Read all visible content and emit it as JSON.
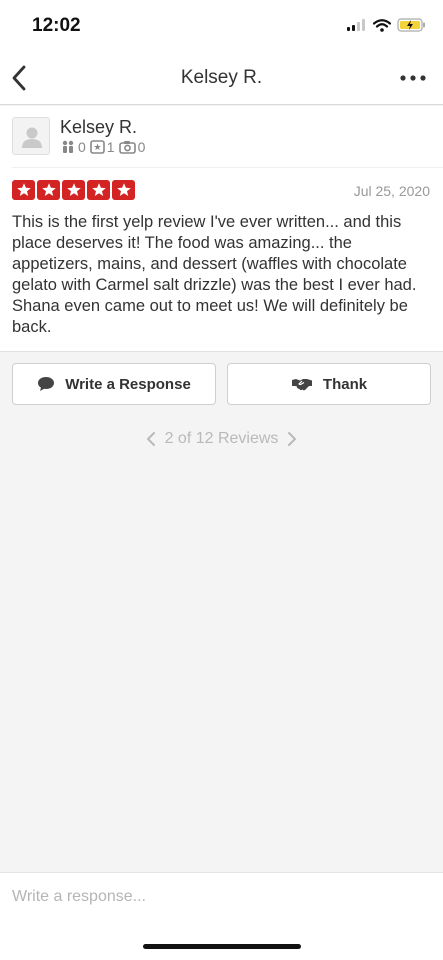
{
  "status_bar": {
    "time": "12:02"
  },
  "nav": {
    "title": "Kelsey R."
  },
  "review": {
    "author": "Kelsey R.",
    "stats": {
      "friends": "0",
      "reviews": "1",
      "photos": "0"
    },
    "rating": 5,
    "date": "Jul 25, 2020",
    "text": "This is the first yelp review I've ever written... and this place deserves it! The food was amazing... the appetizers, mains, and dessert (waffles with chocolate gelato with Carmel salt drizzle) was the best I ever had. Shana even came out to meet us! We will definitely be back."
  },
  "actions": {
    "write_response": "Write a Response",
    "thank": "Thank"
  },
  "pager": {
    "label": "2 of 12 Reviews"
  },
  "composer": {
    "placeholder": "Write a response..."
  },
  "colors": {
    "star_red": "#d32323",
    "background": "#f4f4f4"
  },
  "icons": [
    "back-arrow-icon",
    "more-dots-icon",
    "avatar-placeholder-icon",
    "friends-icon",
    "review-count-icon",
    "camera-icon",
    "star-icon",
    "speech-bubble-icon",
    "handshake-icon",
    "chevron-left-icon",
    "chevron-right-icon",
    "signal-icon",
    "wifi-icon",
    "battery-icon"
  ]
}
